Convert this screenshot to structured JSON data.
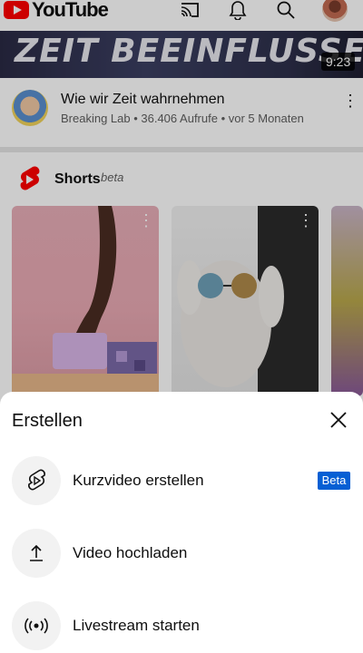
{
  "app": {
    "logo_text": "YouTube"
  },
  "header": {
    "icons": [
      "cast-icon",
      "notifications-bell-icon",
      "search-icon",
      "account-avatar"
    ]
  },
  "video": {
    "thumbnail_text": "ZEIT BEEINFLUSSEN?",
    "duration": "9:23",
    "title": "Wie wir Zeit wahrnehmen",
    "meta": "Breaking Lab • 36.406 Aufrufe • vor 5 Monaten",
    "menu_icon": "more-vert-icon"
  },
  "shorts": {
    "label": "Shorts",
    "badge": "beta",
    "icon": "shorts-logo-icon"
  },
  "sheet": {
    "title": "Erstellen",
    "close_icon": "close-icon",
    "options": [
      {
        "label": "Kurzvideo erstellen",
        "icon": "shorts-create-icon",
        "badge": "Beta"
      },
      {
        "label": "Video hochladen",
        "icon": "upload-icon"
      },
      {
        "label": "Livestream starten",
        "icon": "live-broadcast-icon"
      }
    ]
  },
  "colors": {
    "brand_red": "#ff0000",
    "beta_badge_blue": "#065fd4",
    "meta_gray": "#606060"
  }
}
